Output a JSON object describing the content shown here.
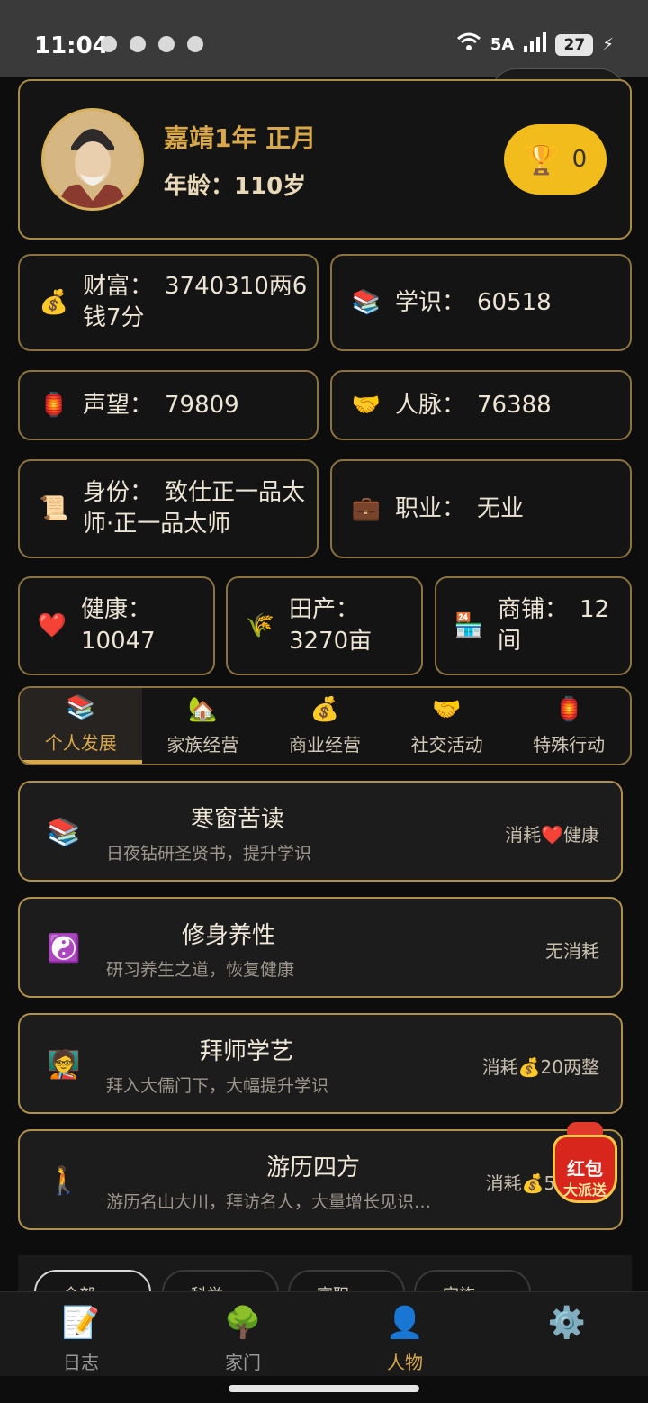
{
  "status_bar": {
    "time": "11:04",
    "network": "5A",
    "battery": "27"
  },
  "profile": {
    "reign": "嘉靖1年 正月",
    "age": "年龄：110岁",
    "trophy_count": "0"
  },
  "stats": {
    "wealth": "财富：　3740310两6钱7分",
    "knowledge": "学识：　60518",
    "prestige": "声望：　79809",
    "connections": "人脉：　76388",
    "identity": "身份：　致仕正一品太师·正一品太师",
    "occupation": "职业：　无业",
    "health": "健康：　10047",
    "land": "田产：　3270亩",
    "shops": "商铺：　12间"
  },
  "tabs": [
    "个人发展",
    "家族经营",
    "商业经营",
    "社交活动",
    "特殊行动"
  ],
  "actions": [
    {
      "name": "寒窗苦读",
      "desc": "日夜钻研圣贤书，提升学识",
      "cost": "消耗❤️健康"
    },
    {
      "name": "修身养性",
      "desc": "研习养生之道，恢复健康",
      "cost": "无消耗"
    },
    {
      "name": "拜师学艺",
      "desc": "拜入大儒门下，大幅提升学识",
      "cost": "消耗💰20两整"
    },
    {
      "name": "游历四方",
      "desc": "游历名山大川，拜访名人，大量增长见识…",
      "cost": "消耗💰50"
    }
  ],
  "red_packet": {
    "line1": "红包",
    "line2": "大派送"
  },
  "filters": [
    "全部",
    "科举",
    "官职",
    "宗族"
  ],
  "bottom_nav": [
    "日志",
    "家门",
    "人物",
    ""
  ],
  "colors": {
    "accent_gold": "#d8a84a",
    "card_border": "#8a7340",
    "trophy_yellow": "#f2bd1c"
  }
}
